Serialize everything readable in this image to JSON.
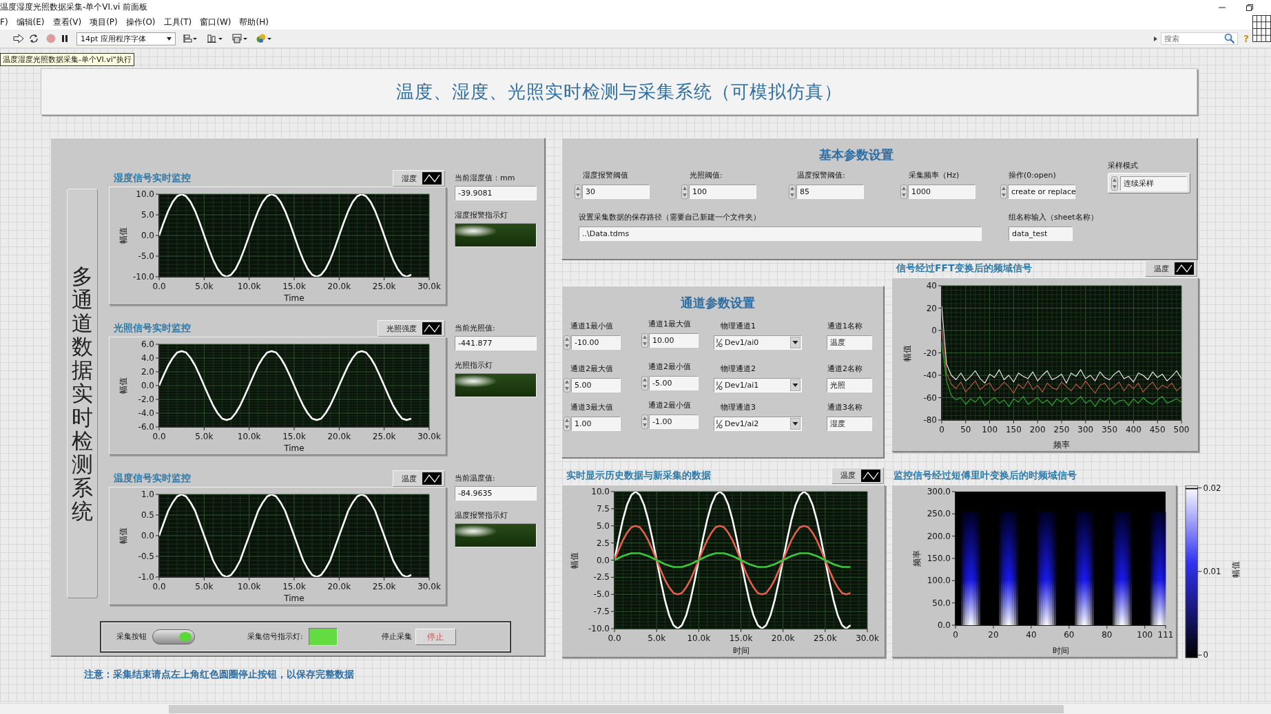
{
  "window": {
    "title": "温度湿度光照数据采集-单个VI.vi 前面板"
  },
  "menu": [
    "F)",
    "编辑(E)",
    "查看(V)",
    "项目(P)",
    "操作(O)",
    "工具(T)",
    "窗口(W)",
    "帮助(H)"
  ],
  "toolbar": {
    "font_menu": "14pt 应用程序字体",
    "search": {
      "placeholder": "搜索"
    },
    "help": "?",
    "tooltip": "温度湿度光照数据采集-单个VI.vi\"执行"
  },
  "banner": {
    "title": "温度、湿度、光照实时检测与采集系统（可模拟仿真）"
  },
  "monitor_panel": {
    "side_title": "多通道数据实时检测系统",
    "channels": [
      {
        "reading_label": "当前湿度值：mm",
        "reading": "-39.9081",
        "lamp_label": "湿度报警指示灯",
        "lamp_on": false,
        "chart_data": {
          "type": "line",
          "grid": true,
          "title": "湿度信号实时监控",
          "xlabel": "Time",
          "ylabel": "幅值",
          "xlim": [
            0,
            30000
          ],
          "ylim": [
            -10,
            10
          ],
          "xticks": [
            {
              "value": 0,
              "label": "0.0"
            },
            {
              "value": 5000,
              "label": "5.0k"
            },
            {
              "value": 10000,
              "label": "10.0k"
            },
            {
              "value": 15000,
              "label": "15.0k"
            },
            {
              "value": 20000,
              "label": "20.0k"
            },
            {
              "value": 25000,
              "label": "25.0k"
            },
            {
              "value": 30000,
              "label": "30.0k"
            }
          ],
          "yticks": [
            {
              "value": 10,
              "label": "10.0"
            },
            {
              "value": 5,
              "label": "5.0"
            },
            {
              "value": 0,
              "label": "0.0"
            },
            {
              "value": -5,
              "label": "-5.0"
            },
            {
              "value": -10,
              "label": "-10.0"
            }
          ],
          "x": [
            0,
            500,
            1000,
            1500,
            2000,
            2500,
            3000,
            3500,
            4000,
            4500,
            5000,
            5500,
            6000,
            6500,
            7000,
            7500,
            8000,
            8500,
            9000,
            9500,
            10000,
            10500,
            11000,
            11500,
            12000,
            12500,
            13000,
            13500,
            14000,
            14500,
            15000,
            15500,
            16000,
            16500,
            17000,
            17500,
            18000,
            18500,
            19000,
            19500,
            20000,
            20500,
            21000,
            21500,
            22000,
            22500,
            23000,
            23500,
            24000,
            24500,
            25000,
            25500,
            26000,
            26500,
            27000,
            27500,
            28000
          ],
          "series": [
            {
              "name": "湿度",
              "color": "#ffffff",
              "values": [
                0,
                3.1,
                5.9,
                8.1,
                9.5,
                10,
                9.5,
                8.1,
                5.9,
                3.1,
                0,
                -3.1,
                -5.9,
                -8.1,
                -9.5,
                -10,
                -9.5,
                -8.1,
                -5.9,
                -3.1,
                0,
                3.1,
                5.9,
                8.1,
                9.5,
                10,
                9.5,
                8.1,
                5.9,
                3.1,
                0,
                -3.1,
                -5.9,
                -8.1,
                -9.5,
                -10,
                -9.5,
                -8.1,
                -5.9,
                -3.1,
                0,
                3.1,
                5.9,
                8.1,
                9.5,
                10,
                9.5,
                8.1,
                5.9,
                3.1,
                0,
                -3.1,
                -5.9,
                -8.1,
                -9.5,
                -10,
                -9.5
              ]
            }
          ]
        }
      },
      {
        "reading_label": "当前光照值:",
        "reading": "-441.877",
        "lamp_label": "光照指示灯",
        "lamp_on": false,
        "chart_data": {
          "type": "line",
          "grid": true,
          "title": "光照信号实时监控",
          "xlabel": "Time",
          "ylabel": "幅值",
          "xlim": [
            0,
            30000
          ],
          "ylim": [
            -6,
            6
          ],
          "xticks": [
            {
              "value": 0,
              "label": "0.0"
            },
            {
              "value": 5000,
              "label": "5.0k"
            },
            {
              "value": 10000,
              "label": "10.0k"
            },
            {
              "value": 15000,
              "label": "15.0k"
            },
            {
              "value": 20000,
              "label": "20.0k"
            },
            {
              "value": 25000,
              "label": "25.0k"
            },
            {
              "value": 30000,
              "label": "30.0k"
            }
          ],
          "yticks": [
            {
              "value": 6,
              "label": "6.0"
            },
            {
              "value": 4,
              "label": "4.0"
            },
            {
              "value": 2,
              "label": "2.0"
            },
            {
              "value": 0,
              "label": "0.0"
            },
            {
              "value": -2,
              "label": "-2.0"
            },
            {
              "value": -4,
              "label": "-4.0"
            },
            {
              "value": -6,
              "label": "-6.0"
            }
          ],
          "x": [
            0,
            500,
            1000,
            1500,
            2000,
            2500,
            3000,
            3500,
            4000,
            4500,
            5000,
            5500,
            6000,
            6500,
            7000,
            7500,
            8000,
            8500,
            9000,
            9500,
            10000,
            10500,
            11000,
            11500,
            12000,
            12500,
            13000,
            13500,
            14000,
            14500,
            15000,
            15500,
            16000,
            16500,
            17000,
            17500,
            18000,
            18500,
            19000,
            19500,
            20000,
            20500,
            21000,
            21500,
            22000,
            22500,
            23000,
            23500,
            24000,
            24500,
            25000,
            25500,
            26000,
            26500,
            27000,
            27500,
            28000
          ],
          "series": [
            {
              "name": "光照强度",
              "color": "#ffffff",
              "values": [
                0,
                1.5,
                2.9,
                4,
                4.8,
                5,
                4.8,
                4,
                2.9,
                1.5,
                0,
                -1.5,
                -2.9,
                -4,
                -4.8,
                -5,
                -4.8,
                -4,
                -2.9,
                -1.5,
                0,
                1.5,
                2.9,
                4,
                4.8,
                5,
                4.8,
                4,
                2.9,
                1.5,
                0,
                -1.5,
                -2.9,
                -4,
                -4.8,
                -5,
                -4.8,
                -4,
                -2.9,
                -1.5,
                0,
                1.5,
                2.9,
                4,
                4.8,
                5,
                4.8,
                4,
                2.9,
                1.5,
                0,
                -1.5,
                -2.9,
                -4,
                -4.8,
                -5,
                -4.8
              ]
            }
          ]
        }
      },
      {
        "reading_label": "当前温度值:",
        "reading": "-84.9635",
        "lamp_label": "温度报警指示灯",
        "lamp_on": false,
        "chart_data": {
          "type": "line",
          "grid": true,
          "title": "温度信号实时监控",
          "xlabel": "Time",
          "ylabel": "幅值",
          "xlim": [
            0,
            30000
          ],
          "ylim": [
            -1,
            1
          ],
          "xticks": [
            {
              "value": 0,
              "label": "0.0"
            },
            {
              "value": 5000,
              "label": "5.0k"
            },
            {
              "value": 10000,
              "label": "10.0k"
            },
            {
              "value": 15000,
              "label": "15.0k"
            },
            {
              "value": 20000,
              "label": "20.0k"
            },
            {
              "value": 25000,
              "label": "25.0k"
            },
            {
              "value": 30000,
              "label": "30.0k"
            }
          ],
          "yticks": [
            {
              "value": 1,
              "label": "1.0"
            },
            {
              "value": 0.5,
              "label": "0.5"
            },
            {
              "value": 0,
              "label": "0.0"
            },
            {
              "value": -0.5,
              "label": "-0.5"
            },
            {
              "value": -1,
              "label": "-1.0"
            }
          ],
          "x": [
            0,
            500,
            1000,
            1500,
            2000,
            2500,
            3000,
            3500,
            4000,
            4500,
            5000,
            5500,
            6000,
            6500,
            7000,
            7500,
            8000,
            8500,
            9000,
            9500,
            10000,
            10500,
            11000,
            11500,
            12000,
            12500,
            13000,
            13500,
            14000,
            14500,
            15000,
            15500,
            16000,
            16500,
            17000,
            17500,
            18000,
            18500,
            19000,
            19500,
            20000,
            20500,
            21000,
            21500,
            22000,
            22500,
            23000,
            23500,
            24000,
            24500,
            25000,
            25500,
            26000,
            26500,
            27000,
            27500,
            28000
          ],
          "series": [
            {
              "name": "温度",
              "color": "#ffffff",
              "values": [
                0,
                0.3,
                0.6,
                0.8,
                0.95,
                1,
                0.95,
                0.8,
                0.6,
                0.3,
                0,
                -0.3,
                -0.6,
                -0.8,
                -0.95,
                -1,
                -0.95,
                -0.8,
                -0.6,
                -0.3,
                0,
                0.3,
                0.6,
                0.8,
                0.95,
                1,
                0.95,
                0.8,
                0.6,
                0.3,
                0,
                -0.3,
                -0.6,
                -0.8,
                -0.95,
                -1,
                -0.95,
                -0.8,
                -0.6,
                -0.3,
                0,
                0.3,
                0.6,
                0.8,
                0.95,
                1,
                0.95,
                0.8,
                0.6,
                0.3,
                0,
                -0.3,
                -0.6,
                -0.8,
                -0.95,
                -1,
                -0.95
              ]
            }
          ]
        }
      }
    ],
    "controls": {
      "acquire_label": "采集按钮",
      "acquire_on": true,
      "indicator_label": "采集信号指示灯:",
      "indicator_on": true,
      "stop_label": "停止采集",
      "stop_button": "停止"
    }
  },
  "basic_settings": {
    "title": "基本参数设置",
    "inputs": [
      {
        "label": "湿度报警阈值",
        "value": "30"
      },
      {
        "label": "光照阈值:",
        "value": "100"
      },
      {
        "label": "温度报警阈值:",
        "value": "85"
      },
      {
        "label": "采集频率（Hz)",
        "value": "1000"
      },
      {
        "label": "操作(0:open)",
        "value": "create or replace"
      }
    ],
    "sample_mode": {
      "label": "采样模式",
      "value": "连续采样"
    },
    "save_path": {
      "label": "设置采集数据的保存路径（需要自己新建一个文件夹）",
      "value": "..\\Data.tdms"
    },
    "group_name": {
      "label": "组名称输入（sheet名称）",
      "value": "data_test"
    }
  },
  "channel_settings": {
    "title": "通道参数设置",
    "rows": [
      {
        "cells": [
          {
            "kind": "numeric",
            "label": "通道1最小值",
            "value": "-10.00"
          },
          {
            "kind": "numeric",
            "label": "通道1最大值",
            "value": "10.00"
          },
          {
            "kind": "channel",
            "label": "物理通道1",
            "value": "Dev1/ai0"
          },
          {
            "kind": "text",
            "label": "通道1名称",
            "value": "温度"
          }
        ]
      },
      {
        "cells": [
          {
            "kind": "numeric",
            "label": "通道2最大值",
            "value": "5.00"
          },
          {
            "kind": "numeric",
            "label": "通道2最小值",
            "value": "-5.00"
          },
          {
            "kind": "channel",
            "label": "物理通道2",
            "value": "Dev1/ai1"
          },
          {
            "kind": "text",
            "label": "通道2名称",
            "value": "光照"
          }
        ]
      },
      {
        "cells": [
          {
            "kind": "numeric",
            "label": "通道3最大值",
            "value": "1.00"
          },
          {
            "kind": "numeric",
            "label": "通道2最小值",
            "value": "-1.00"
          },
          {
            "kind": "channel",
            "label": "物理通道3",
            "value": "Dev1/ai2"
          },
          {
            "kind": "text",
            "label": "通道3名称",
            "value": "湿度"
          }
        ]
      }
    ]
  },
  "fft_graph": {
    "chart_data": {
      "type": "line",
      "grid": true,
      "title": "信号经过FFT变换后的频域信号",
      "xlabel": "频率",
      "ylabel": "幅值",
      "xlim": [
        0,
        500
      ],
      "ylim": [
        -80,
        40
      ],
      "xticks": [
        {
          "value": 0,
          "label": "0"
        },
        {
          "value": 50,
          "label": "50"
        },
        {
          "value": 100,
          "label": "100"
        },
        {
          "value": 150,
          "label": "150"
        },
        {
          "value": 200,
          "label": "200"
        },
        {
          "value": 250,
          "label": "250"
        },
        {
          "value": 300,
          "label": "300"
        },
        {
          "value": 350,
          "label": "350"
        },
        {
          "value": 400,
          "label": "400"
        },
        {
          "value": 450,
          "label": "450"
        },
        {
          "value": 500,
          "label": "500"
        }
      ],
      "yticks": [
        {
          "value": 40,
          "label": "40"
        },
        {
          "value": 20,
          "label": "20"
        },
        {
          "value": 0,
          "label": "0"
        },
        {
          "value": -20,
          "label": "-20"
        },
        {
          "value": -40,
          "label": "-40"
        },
        {
          "value": -60,
          "label": "-60"
        },
        {
          "value": -80,
          "label": "-80"
        }
      ],
      "x": [
        0,
        10,
        20,
        30,
        40,
        50,
        60,
        70,
        80,
        90,
        100,
        110,
        120,
        130,
        140,
        150,
        160,
        170,
        180,
        190,
        200,
        210,
        220,
        230,
        240,
        250,
        260,
        270,
        280,
        290,
        300,
        310,
        320,
        330,
        340,
        350,
        360,
        370,
        380,
        390,
        400,
        410,
        420,
        430,
        440,
        450,
        460,
        470,
        480,
        490,
        500
      ],
      "series": [
        {
          "name": "温度",
          "color": "#f4f4f4",
          "values": [
            22,
            -30,
            -40,
            -44,
            -38,
            -45,
            -41,
            -36,
            -43,
            -47,
            -39,
            -42,
            -35,
            -44,
            -40,
            -46,
            -38,
            -41,
            -43,
            -37,
            -45,
            -40,
            -36,
            -44,
            -42,
            -39,
            -47,
            -38,
            -41,
            -35,
            -43,
            -40,
            -45,
            -37,
            -42,
            -44,
            -39,
            -36,
            -43,
            -41,
            -46,
            -38,
            -40,
            -44,
            -37,
            -42,
            -39,
            -45,
            -41,
            -36,
            -43
          ]
        },
        {
          "color": "#c4584a",
          "values": [
            4,
            -38,
            -48,
            -52,
            -46,
            -55,
            -50,
            -45,
            -53,
            -49,
            -47,
            -54,
            -51,
            -46,
            -50,
            -56,
            -48,
            -52,
            -45,
            -53,
            -49,
            -55,
            -47,
            -51,
            -53,
            -46,
            -50,
            -54,
            -48,
            -52,
            -45,
            -51,
            -56,
            -49,
            -47,
            -53,
            -50,
            -46,
            -54,
            -48,
            -52,
            -47,
            -55,
            -50,
            -46,
            -53,
            -49,
            -51,
            -47,
            -54,
            -50
          ]
        },
        {
          "color": "#2fb52f",
          "values": [
            -10,
            -45,
            -58,
            -62,
            -60,
            -66,
            -61,
            -64,
            -59,
            -67,
            -63,
            -60,
            -65,
            -62,
            -68,
            -61,
            -64,
            -59,
            -66,
            -63,
            -60,
            -65,
            -62,
            -67,
            -61,
            -64,
            -60,
            -66,
            -63,
            -59,
            -65,
            -62,
            -68,
            -61,
            -64,
            -60,
            -66,
            -63,
            -62,
            -67,
            -61,
            -65,
            -60,
            -64,
            -66,
            -62,
            -59,
            -65,
            -63,
            -61,
            -64
          ]
        }
      ]
    }
  },
  "history_graph": {
    "chart_data": {
      "type": "line",
      "grid": true,
      "title": "实时显示历史数据与新采集的数据",
      "xlabel": "时间",
      "ylabel": "幅值",
      "xlim": [
        0,
        30000
      ],
      "ylim": [
        -10,
        10
      ],
      "xticks": [
        {
          "value": 0,
          "label": "0.0"
        },
        {
          "value": 5000,
          "label": "5.0k"
        },
        {
          "value": 10000,
          "label": "10.0k"
        },
        {
          "value": 15000,
          "label": "15.0k"
        },
        {
          "value": 20000,
          "label": "20.0k"
        },
        {
          "value": 25000,
          "label": "25.0k"
        },
        {
          "value": 30000,
          "label": "30.0k"
        }
      ],
      "yticks": [
        {
          "value": 10,
          "label": "10.0"
        },
        {
          "value": 7.5,
          "label": "7.5"
        },
        {
          "value": 5,
          "label": "5.0"
        },
        {
          "value": 2.5,
          "label": "2.5"
        },
        {
          "value": 0,
          "label": "0.0"
        },
        {
          "value": -2.5,
          "label": "-2.5"
        },
        {
          "value": -5,
          "label": "-5.0"
        },
        {
          "value": -7.5,
          "label": "-7.5"
        },
        {
          "value": -10,
          "label": "-10.0"
        }
      ],
      "x": [
        0,
        500,
        1000,
        1500,
        2000,
        2500,
        3000,
        3500,
        4000,
        4500,
        5000,
        5500,
        6000,
        6500,
        7000,
        7500,
        8000,
        8500,
        9000,
        9500,
        10000,
        10500,
        11000,
        11500,
        12000,
        12500,
        13000,
        13500,
        14000,
        14500,
        15000,
        15500,
        16000,
        16500,
        17000,
        17500,
        18000,
        18500,
        19000,
        19500,
        20000,
        20500,
        21000,
        21500,
        22000,
        22500,
        23000,
        23500,
        24000,
        24500,
        25000,
        25500,
        26000,
        26500,
        27000,
        27500,
        28000
      ],
      "series": [
        {
          "name": "温度",
          "color": "#ffffff",
          "values": [
            0,
            3.1,
            5.9,
            8.1,
            9.5,
            10,
            9.5,
            8.1,
            5.9,
            3.1,
            0,
            -3.1,
            -5.9,
            -8.1,
            -9.5,
            -10,
            -9.5,
            -8.1,
            -5.9,
            -3.1,
            0,
            3.1,
            5.9,
            8.1,
            9.5,
            10,
            9.5,
            8.1,
            5.9,
            3.1,
            0,
            -3.1,
            -5.9,
            -8.1,
            -9.5,
            -10,
            -9.5,
            -8.1,
            -5.9,
            -3.1,
            0,
            3.1,
            5.9,
            8.1,
            9.5,
            10,
            9.5,
            8.1,
            5.9,
            3.1,
            0,
            -3.1,
            -5.9,
            -8.1,
            -9.5,
            -10,
            -9.5
          ]
        },
        {
          "color": "#e8604c",
          "values": [
            0,
            1.5,
            2.9,
            4,
            4.8,
            5,
            4.8,
            4,
            2.9,
            1.5,
            0,
            -1.5,
            -2.9,
            -4,
            -4.8,
            -5,
            -4.8,
            -4,
            -2.9,
            -1.5,
            0,
            1.5,
            2.9,
            4,
            4.8,
            5,
            4.8,
            4,
            2.9,
            1.5,
            0,
            -1.5,
            -2.9,
            -4,
            -4.8,
            -5,
            -4.8,
            -4,
            -2.9,
            -1.5,
            0,
            1.5,
            2.9,
            4,
            4.8,
            5,
            4.8,
            4,
            2.9,
            1.5,
            0,
            -1.5,
            -2.9,
            -4,
            -4.8,
            -5,
            -4.8
          ]
        },
        {
          "color": "#3cc83c",
          "values": [
            0,
            0.3,
            0.6,
            0.8,
            1,
            1,
            1,
            0.8,
            0.6,
            0.3,
            0,
            -0.3,
            -0.6,
            -0.8,
            -1,
            -1,
            -1,
            -0.8,
            -0.6,
            -0.3,
            0,
            0.3,
            0.6,
            0.8,
            1,
            1,
            1,
            0.8,
            0.6,
            0.3,
            0,
            -0.3,
            -0.6,
            -0.8,
            -1,
            -1,
            -1,
            -0.8,
            -0.6,
            -0.3,
            0,
            0.3,
            0.6,
            0.8,
            1,
            1,
            1,
            0.8,
            0.6,
            0.3,
            0,
            -0.3,
            -0.6,
            -0.8,
            -1,
            -1,
            -1
          ]
        }
      ]
    }
  },
  "spectrogram": {
    "title": "监控信号经过短傅里叶变换后的时频域信号",
    "x_label": "时间",
    "y_label": "频率",
    "x_ticks": [
      "0",
      "20",
      "40",
      "60",
      "80",
      "100",
      "111"
    ],
    "y_ticks": [
      "300.0",
      "250.0",
      "200.0",
      "150.0",
      "100.0",
      "50.0",
      "0.0"
    ],
    "scale_label": "幅值",
    "scale_ticks": [
      "0.02",
      "0.01",
      "0"
    ]
  },
  "note": "注意：采集结束请点左上角红色圆圈停止按钮，以保存完整数据"
}
